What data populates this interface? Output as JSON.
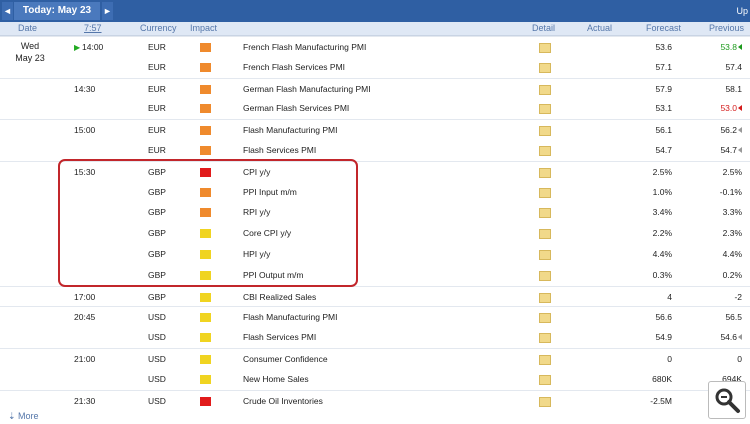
{
  "nav": {
    "prev_arrow": "◄",
    "title": "Today: May 23",
    "next_arrow": "►",
    "up": "Up"
  },
  "header": {
    "date": "Date",
    "time": "7:57",
    "currency": "Currency",
    "impact": "Impact",
    "detail": "Detail",
    "actual": "Actual",
    "forecast": "Forecast",
    "previous": "Previous"
  },
  "date_cell": {
    "line1": "Wed",
    "line2": "May 23"
  },
  "colors": {
    "high": "#e11b1b",
    "medium": "#ef8a2d",
    "low": "#f0d421"
  },
  "rows": [
    {
      "time": "14:00",
      "current": true,
      "currency": "EUR",
      "impact": "medium",
      "event": "French Flash Manufacturing PMI",
      "actual": "",
      "forecast": "53.6",
      "previous": "53.8",
      "prev_mark": "green"
    },
    {
      "time": "",
      "currency": "EUR",
      "impact": "medium",
      "event": "French Flash Services PMI",
      "actual": "",
      "forecast": "57.1",
      "previous": "57.4",
      "prev_mark": ""
    },
    {
      "time": "14:30",
      "currency": "EUR",
      "impact": "medium",
      "event": "German Flash Manufacturing PMI",
      "actual": "",
      "forecast": "57.9",
      "previous": "58.1",
      "prev_mark": ""
    },
    {
      "time": "",
      "currency": "EUR",
      "impact": "medium",
      "event": "German Flash Services PMI",
      "actual": "",
      "forecast": "53.1",
      "previous": "53.0",
      "prev_mark": "red"
    },
    {
      "time": "15:00",
      "currency": "EUR",
      "impact": "medium",
      "event": "Flash Manufacturing PMI",
      "actual": "",
      "forecast": "56.1",
      "previous": "56.2",
      "prev_mark": "gray"
    },
    {
      "time": "",
      "currency": "EUR",
      "impact": "medium",
      "event": "Flash Services PMI",
      "actual": "",
      "forecast": "54.7",
      "previous": "54.7",
      "prev_mark": "gray"
    },
    {
      "time": "15:30",
      "currency": "GBP",
      "impact": "high",
      "event": "CPI y/y",
      "actual": "",
      "forecast": "2.5%",
      "previous": "2.5%",
      "prev_mark": ""
    },
    {
      "time": "",
      "currency": "GBP",
      "impact": "medium",
      "event": "PPI Input m/m",
      "actual": "",
      "forecast": "1.0%",
      "previous": "-0.1%",
      "prev_mark": ""
    },
    {
      "time": "",
      "currency": "GBP",
      "impact": "medium",
      "event": "RPI y/y",
      "actual": "",
      "forecast": "3.4%",
      "previous": "3.3%",
      "prev_mark": ""
    },
    {
      "time": "",
      "currency": "GBP",
      "impact": "low",
      "event": "Core CPI y/y",
      "actual": "",
      "forecast": "2.2%",
      "previous": "2.3%",
      "prev_mark": ""
    },
    {
      "time": "",
      "currency": "GBP",
      "impact": "low",
      "event": "HPI y/y",
      "actual": "",
      "forecast": "4.4%",
      "previous": "4.4%",
      "prev_mark": ""
    },
    {
      "time": "",
      "currency": "GBP",
      "impact": "low",
      "event": "PPI Output m/m",
      "actual": "",
      "forecast": "0.3%",
      "previous": "0.2%",
      "prev_mark": ""
    },
    {
      "time": "17:00",
      "currency": "GBP",
      "impact": "low",
      "event": "CBI Realized Sales",
      "actual": "",
      "forecast": "4",
      "previous": "-2",
      "prev_mark": ""
    },
    {
      "time": "20:45",
      "currency": "USD",
      "impact": "low",
      "event": "Flash Manufacturing PMI",
      "actual": "",
      "forecast": "56.6",
      "previous": "56.5",
      "prev_mark": ""
    },
    {
      "time": "",
      "currency": "USD",
      "impact": "low",
      "event": "Flash Services PMI",
      "actual": "",
      "forecast": "54.9",
      "previous": "54.6",
      "prev_mark": "gray"
    },
    {
      "time": "21:00",
      "currency": "USD",
      "impact": "low",
      "event": "Consumer Confidence",
      "actual": "",
      "forecast": "0",
      "previous": "0",
      "prev_mark": ""
    },
    {
      "time": "",
      "currency": "USD",
      "impact": "low",
      "event": "New Home Sales",
      "actual": "",
      "forecast": "680K",
      "previous": "694K",
      "prev_mark": ""
    },
    {
      "time": "21:30",
      "currency": "USD",
      "impact": "high",
      "event": "Crude Oil Inventories",
      "actual": "",
      "forecast": "-2.5M",
      "previous": "M",
      "prev_mark": ""
    }
  ],
  "footer": {
    "more": "More",
    "more_icon": "arrow-down-icon",
    "zoom_icon": "magnifier-icon"
  }
}
